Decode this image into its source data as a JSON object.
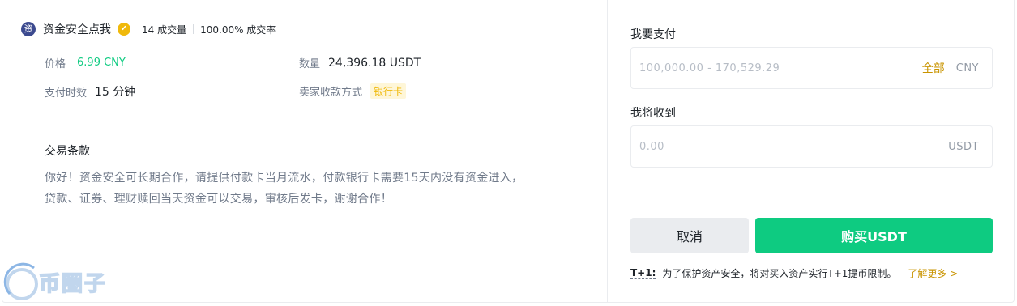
{
  "merchant": {
    "avatar_char": "资",
    "name": "资金安全点我",
    "verified_icon": "✔",
    "trades": "14 成交量",
    "completion": "100.00% 成交率"
  },
  "details": {
    "price_label": "价格",
    "price_value": "6.99 CNY",
    "amount_label": "数量",
    "amount_value": "24,396.18 USDT",
    "time_label": "支付时效",
    "time_value": "15 分钟",
    "method_label": "卖家收款方式",
    "method_value": "银行卡"
  },
  "terms": {
    "title": "交易条款",
    "line1": "你好！资金安全可长期合作，请提供付款卡当月流水，付款银行卡需要15天内没有资金进入，",
    "line2": "贷款、证券、理财赎回当天资金可以交易，审核后发卡，谢谢合作！"
  },
  "order": {
    "pay_label": "我要支付",
    "pay_placeholder": "100,000.00 - 170,529.29",
    "pay_all": "全部",
    "pay_unit": "CNY",
    "receive_label": "我将收到",
    "receive_placeholder": "0.00",
    "receive_unit": "USDT",
    "cancel_label": "取消",
    "buy_label": "购买USDT",
    "note_tag": "T+1:",
    "note_text": "为了保护资产安全，将对买入资产实行T+1提币限制。",
    "note_link": "了解更多 >"
  },
  "watermark": {
    "text": "币圈子"
  },
  "colors": {
    "accent_green": "#0ecb81",
    "accent_gold": "#c99400",
    "verified": "#f0b90b"
  }
}
